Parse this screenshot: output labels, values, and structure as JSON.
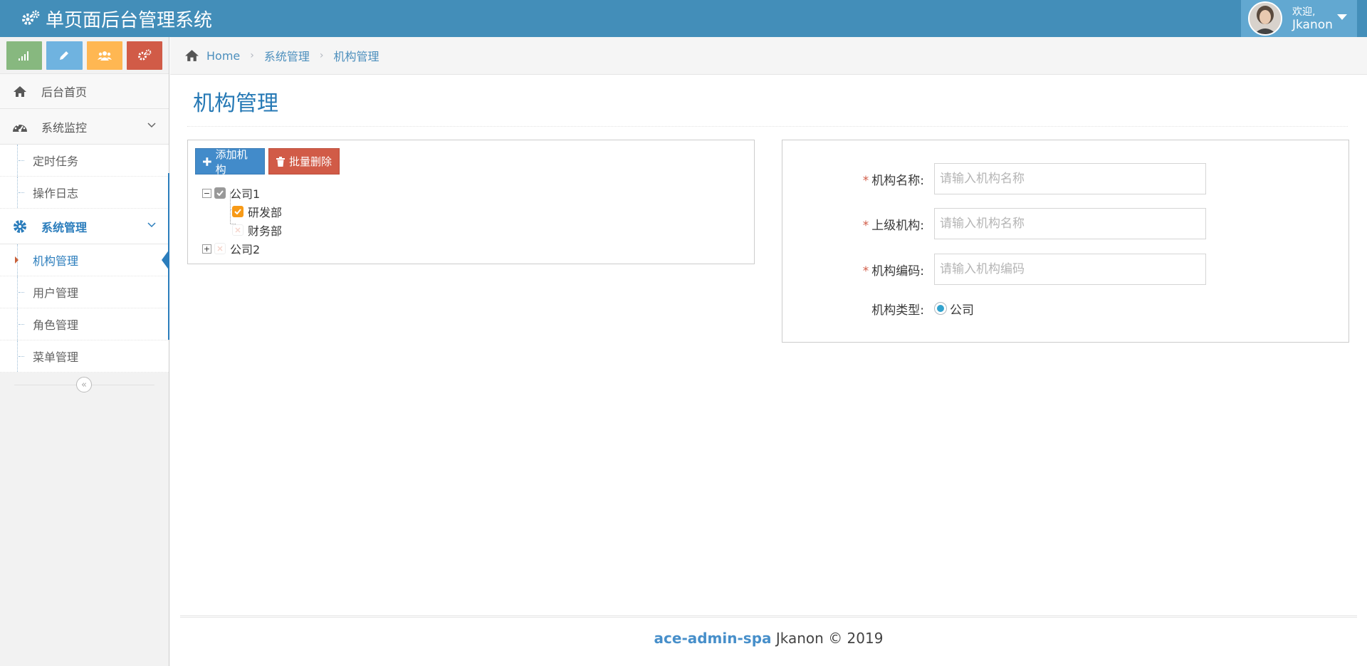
{
  "app": {
    "title": "单页面后台管理系统"
  },
  "user": {
    "welcome": "欢迎,",
    "name": "Jkanon"
  },
  "shortcuts": [
    {
      "icon": "signal-icon",
      "color": "#87B87F"
    },
    {
      "icon": "pencil-icon",
      "color": "#6FB3E0"
    },
    {
      "icon": "users-icon",
      "color": "#FFB752"
    },
    {
      "icon": "cogs-icon",
      "color": "#D15B47"
    }
  ],
  "sidebar": {
    "items": [
      {
        "label": "后台首页",
        "icon": "home-icon"
      },
      {
        "label": "系统监控",
        "icon": "dashboard-icon",
        "children": [
          "定时任务",
          "操作日志"
        ]
      },
      {
        "label": "系统管理",
        "icon": "cog-icon",
        "children": [
          "机构管理",
          "用户管理",
          "角色管理",
          "菜单管理"
        ]
      }
    ]
  },
  "breadcrumb": {
    "home": "Home",
    "level1": "系统管理",
    "level2": "机构管理"
  },
  "page": {
    "title": "机构管理"
  },
  "toolbar": {
    "add_label": "添加机构",
    "delete_label": "批量删除"
  },
  "tree": {
    "nodes": [
      {
        "label": "公司1",
        "expanded": true,
        "checked": "partial"
      },
      {
        "label": "研发部",
        "checked": true
      },
      {
        "label": "财务部",
        "checked": false
      },
      {
        "label": "公司2",
        "expanded": false,
        "checked": false
      }
    ]
  },
  "form": {
    "name": {
      "label": "机构名称:",
      "placeholder": "请输入机构名称",
      "required": true
    },
    "parent": {
      "label": "上级机构:",
      "placeholder": "请输入机构名称",
      "required": true
    },
    "code": {
      "label": "机构编码:",
      "placeholder": "请输入机构编码",
      "required": true
    },
    "type": {
      "label": "机构类型:",
      "option": "公司",
      "selected": true
    }
  },
  "footer": {
    "brand": "ace-admin-spa",
    "text": " Jkanon © 2019"
  },
  "colors": {
    "navbar": "#438EB9",
    "accent": "#2B7DBC",
    "danger": "#D15B47",
    "primary": "#428BCA"
  }
}
